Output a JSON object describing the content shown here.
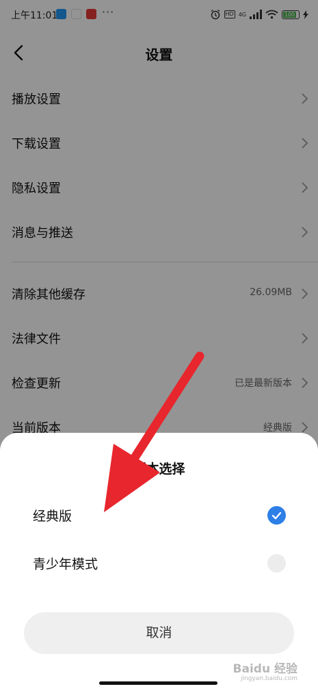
{
  "status_bar": {
    "time": "上午11:01",
    "dots": "···",
    "hd_label": "HD",
    "network": "4G",
    "battery": "100",
    "app_icon_colors": [
      "#2196f3",
      "#e53935",
      "#d32f2f"
    ]
  },
  "header": {
    "title": "设置",
    "back_icon": "chevron-left-icon"
  },
  "settings": {
    "items": [
      {
        "label": "播放设置",
        "value": ""
      },
      {
        "label": "下载设置",
        "value": ""
      },
      {
        "label": "隐私设置",
        "value": ""
      },
      {
        "label": "消息与推送",
        "value": ""
      },
      {
        "label": "清除其他缓存",
        "value": "26.09MB"
      },
      {
        "label": "法律文件",
        "value": ""
      },
      {
        "label": "检查更新",
        "value": "已是最新版本"
      },
      {
        "label": "当前版本",
        "value": "经典版"
      }
    ]
  },
  "sheet": {
    "title": "版本选择",
    "options": [
      {
        "label": "经典版",
        "selected": true
      },
      {
        "label": "青少年模式",
        "selected": false
      }
    ],
    "cancel_label": "取消"
  },
  "watermark": {
    "brand": "Baidu 经验",
    "url": "jingyan.baidu.com"
  },
  "colors": {
    "accent": "#2e7fe6",
    "arrow": "#e8262d",
    "overlay": "rgba(0,0,0,0.42)"
  }
}
